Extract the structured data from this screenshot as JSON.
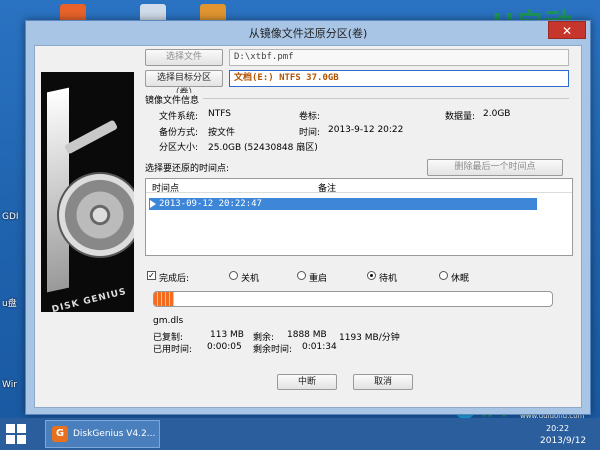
{
  "dialog": {
    "title": "从镜像文件还原分区(卷)",
    "close_symbol": "✕"
  },
  "top": {
    "select_file_label": "选择文件",
    "file_path": "D:\\xtbf.pmf",
    "select_target_label": "选择目标分区（卷）",
    "target_value": "文档(E:) NTFS 37.0GB"
  },
  "image_info": {
    "title": "镜像文件信息",
    "fs_label": "文件系统:",
    "fs_value": "NTFS",
    "volume_label": "卷标:",
    "volume_value": "",
    "data_label": "数据量:",
    "data_value": "2.0GB",
    "method_label": "备份方式:",
    "method_value": "按文件",
    "time_label": "时间:",
    "time_value": "2013-9-12 20:22",
    "size_label": "分区大小:",
    "size_value": "25.0GB  (52430848 扇区)"
  },
  "restore": {
    "title": "选择要还原的时间点:",
    "delete_last_label": "删除最后一个时间点",
    "col_time": "时间点",
    "col_note": "备注",
    "rows": [
      {
        "time": "2013-09-12 20:22:47",
        "note": "",
        "selected": true
      }
    ]
  },
  "after": {
    "done_label": "完成后:",
    "done_checked": true,
    "options": [
      {
        "label": "关机",
        "selected": false
      },
      {
        "label": "重启",
        "selected": false
      },
      {
        "label": "待机",
        "selected": true
      },
      {
        "label": "休眠",
        "selected": false
      }
    ]
  },
  "progress": {
    "fraction": 0.05,
    "current_file": "gm.dls",
    "copied_label": "已复制:",
    "copied_value": "113 MB",
    "remain_label": "剩余:",
    "remain_value": "1888 MB",
    "speed_value": "1193 MB/分钟",
    "elapsed_label": "已用时间:",
    "elapsed_value": "0:00:05",
    "remain_time_label": "剩余时间:",
    "remain_time_value": "0:01:34"
  },
  "buttons": {
    "stop": "中断",
    "cancel": "取消"
  },
  "panel": {
    "brand_text": "DISK GENIUS"
  },
  "desktop": {
    "icons": [
      {
        "label": "GDI",
        "color": "#e8622a"
      },
      {
        "label": "u盘",
        "color": "#3a79c9"
      },
      {
        "label": "Wir",
        "color": "#7a8aa5"
      }
    ],
    "brand_top": "U启动",
    "brand_bottom": "启动",
    "brand_url": "www.uqidong.com"
  },
  "taskbar": {
    "task_label": "DiskGenius V4.2...",
    "task_icon": "G",
    "clock_time": "20:22",
    "clock_date": "2013/9/12"
  }
}
